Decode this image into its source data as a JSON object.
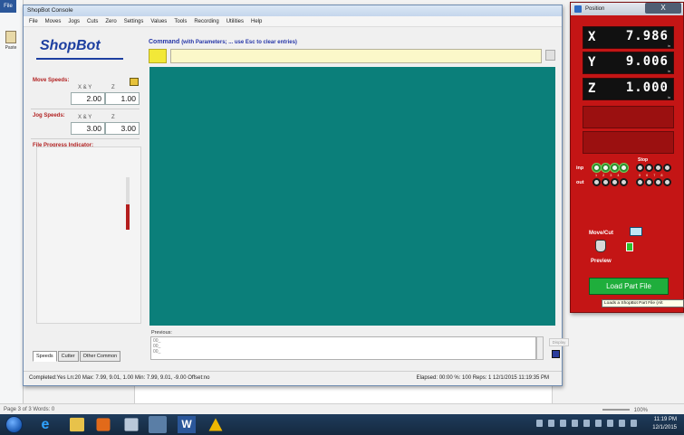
{
  "word": {
    "file_tab": "File",
    "paste_label": "Paste",
    "status_text": "Page 3 of 3   Words: 0",
    "zoom": "100%"
  },
  "shopbot": {
    "window_title": "ShopBot Console",
    "menu": [
      "File",
      "Moves",
      "Jogs",
      "Cuts",
      "Zero",
      "Settings",
      "Values",
      "Tools",
      "Recording",
      "Utilities",
      "Help"
    ],
    "logo": "ShopBot",
    "move_speeds": {
      "label": "Move Speeds:",
      "xy_header": "X & Y",
      "z_header": "Z",
      "xy_value": "2.00",
      "z_value": "1.00"
    },
    "jog_speeds": {
      "label": "Jog Speeds:",
      "xy_header": "X & Y",
      "z_header": "Z",
      "xy_value": "3.00",
      "z_value": "3.00"
    },
    "progress_label": "File Progress Indicator:",
    "progress_fraction": 0.48,
    "tabs": [
      "Speeds",
      "Cutter",
      "Other Common"
    ],
    "command": {
      "title": "Command",
      "hint": "(with Parameters; ... use Esc to clear entries)",
      "input_value": ""
    },
    "previous": {
      "label": "Previous:",
      "lines": [
        "00_",
        "00_",
        "00_"
      ],
      "display_button": "Display"
    },
    "status_left": "Completed:Yes Ln:20 Max: 7.99, 9.01, 1.00 Min: 7.99, 9.01, -9.00 Offset:no",
    "status_right": "Elapsed: 00:00  %: 100  Reps: 1   12/1/2015  11:19:35 PM"
  },
  "position": {
    "title": "Position",
    "close": "X",
    "axes": [
      {
        "letter": "X",
        "value": "7.986",
        "unit": "in"
      },
      {
        "letter": "Y",
        "value": "9.006",
        "unit": "in"
      },
      {
        "letter": "Z",
        "value": "1.000",
        "unit": "in"
      }
    ],
    "stop_label": "Stop",
    "inp_label": "inp",
    "out_label": "out",
    "inp_leds": [
      true,
      true,
      true,
      true,
      false,
      false,
      false,
      false
    ],
    "out_leds": [
      false,
      false,
      false,
      false,
      false,
      false,
      false,
      false
    ],
    "led_numbers": [
      "1",
      "2",
      "3",
      "4",
      "5",
      "6",
      "7",
      "8"
    ],
    "move_cut_label": "Move/Cut",
    "preview_label": "Preview",
    "load_button": "Load Part File",
    "tooltip": "Loads a ShopBot Part File (Alt"
  },
  "taskbar": {
    "time": "11:19 PM",
    "date": "12/1/2015"
  },
  "colors": {
    "console_bg": "#0b7f7a",
    "position_bg": "#c41515",
    "load_button": "#1fae3c",
    "command_input": "#fbf8c9"
  }
}
